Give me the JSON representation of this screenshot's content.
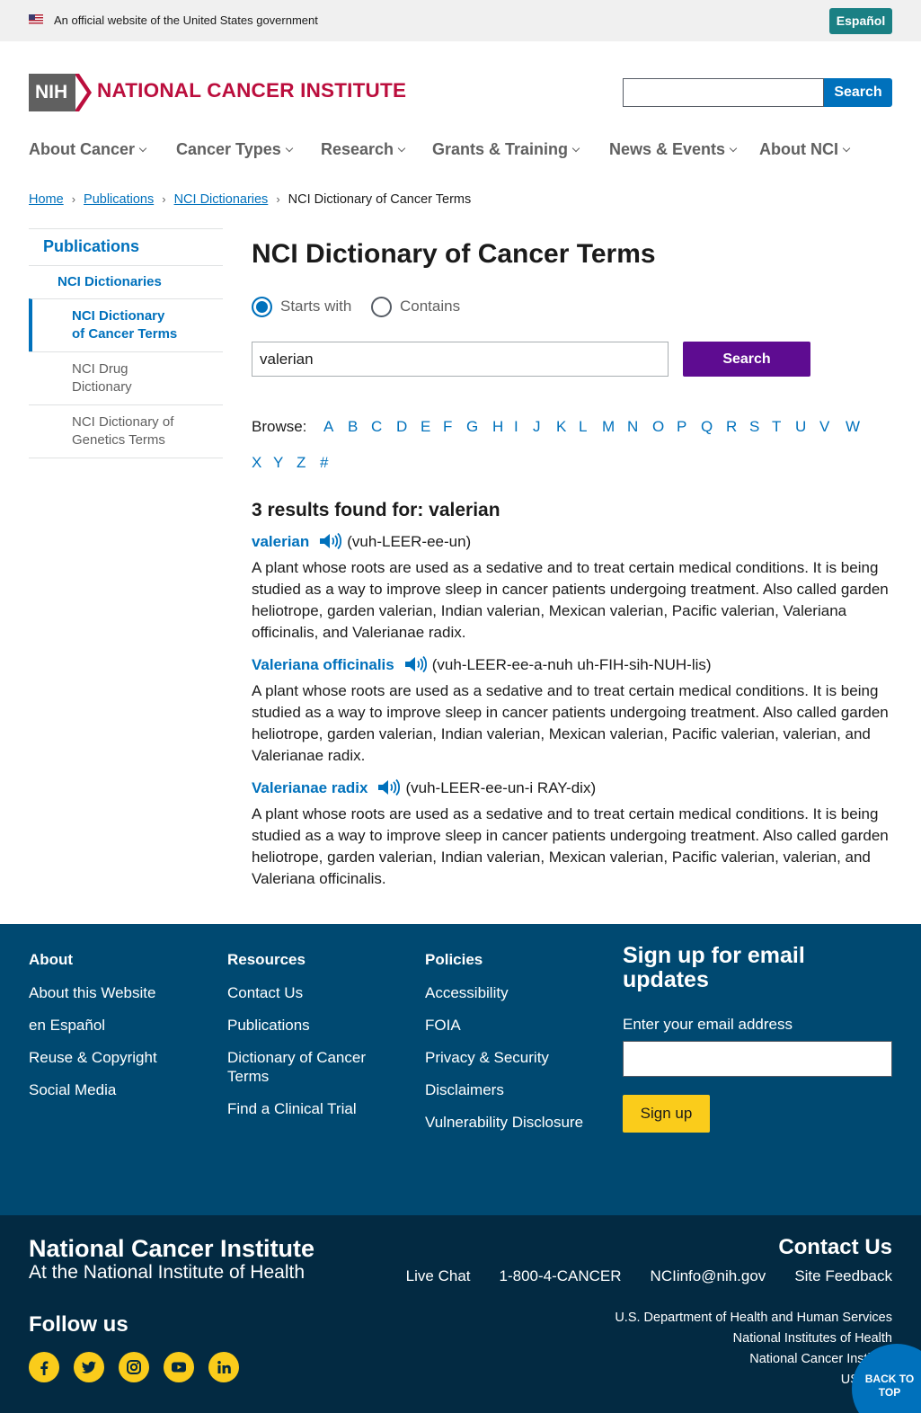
{
  "gov_banner": {
    "text": "An official website of the United States government",
    "espanol": "Español"
  },
  "header": {
    "logo_abbr": "NIH",
    "logo_name": "NATIONAL CANCER INSTITUTE",
    "search_button": "Search"
  },
  "nav": [
    "About Cancer",
    "Cancer Types",
    "Research",
    "Grants & Training",
    "News & Events",
    "About NCI"
  ],
  "breadcrumb": {
    "home": "Home",
    "publications": "Publications",
    "dictionaries": "NCI Dictionaries",
    "current": "NCI Dictionary of Cancer Terms"
  },
  "sidebar": {
    "publications": "Publications",
    "dictionaries": "NCI Dictionaries",
    "cancer_terms": "NCI Dictionary of Cancer Terms",
    "drug": "NCI Drug Dictionary",
    "genetics": "NCI Dictionary of Genetics Terms"
  },
  "main": {
    "title": "NCI Dictionary of Cancer Terms",
    "radio_starts": "Starts with",
    "radio_contains": "Contains",
    "search_value": "valerian",
    "search_button": "Search",
    "browse_label": "Browse:",
    "letters": [
      "A",
      "B",
      "C",
      "D",
      "E",
      "F",
      "G",
      "H",
      "I",
      "J",
      "K",
      "L",
      "M",
      "N",
      "O",
      "P",
      "Q",
      "R",
      "S",
      "T",
      "U",
      "V",
      "W",
      "X",
      "Y",
      "Z",
      "#"
    ],
    "results_heading": "3 results found for: valerian",
    "results": [
      {
        "term": "valerian",
        "pronunciation": "(vuh-LEER-ee-un)",
        "definition": "A plant whose roots are used as a sedative and to treat certain medical conditions. It is being studied as a way to improve sleep in cancer patients undergoing treatment. Also called garden heliotrope, garden valerian, Indian valerian, Mexican valerian, Pacific valerian, Valeriana officinalis, and Valerianae radix."
      },
      {
        "term": "Valeriana officinalis",
        "pronunciation": "(vuh-LEER-ee-a-nuh uh-FIH-sih-NUH-lis)",
        "definition": "A plant whose roots are used as a sedative and to treat certain medical conditions. It is being studied as a way to improve sleep in cancer patients undergoing treatment. Also called garden heliotrope, garden valerian, Indian valerian, Mexican valerian, Pacific valerian, valerian, and Valerianae radix."
      },
      {
        "term": "Valerianae radix",
        "pronunciation": "(vuh-LEER-ee-un-i RAY-dix)",
        "definition": "A plant whose roots are used as a sedative and to treat certain medical conditions. It is being studied as a way to improve sleep in cancer patients undergoing treatment. Also called garden heliotrope, garden valerian, Indian valerian, Mexican valerian, Pacific valerian, valerian, and Valeriana officinalis."
      }
    ]
  },
  "footer": {
    "about": {
      "title": "About",
      "links": [
        "About this Website",
        "en Español",
        "Reuse & Copyright",
        "Social Media"
      ]
    },
    "resources": {
      "title": "Resources",
      "links": [
        "Contact Us",
        "Publications",
        "Dictionary of Cancer Terms",
        "Find a Clinical Trial"
      ]
    },
    "policies": {
      "title": "Policies",
      "links": [
        "Accessibility",
        "FOIA",
        "Privacy & Security",
        "Disclaimers",
        "Vulnerability Disclosure"
      ]
    },
    "signup_title": "Sign up for email updates",
    "signup_label": "Enter your email address",
    "signup_button": "Sign up",
    "nci_name": "National Cancer Institute",
    "nci_sub": "At the National Institute of Health",
    "follow_us": "Follow us",
    "social": [
      "facebook-icon",
      "twitter-icon",
      "instagram-icon",
      "youtube-icon",
      "linkedin-icon"
    ],
    "contact_title": "Contact Us",
    "contact_links": [
      "Live Chat",
      "1-800-4-CANCER",
      "NCIinfo@nih.gov",
      "Site Feedback"
    ],
    "gov_links": [
      "U.S. Department of Health and Human Services",
      "National Institutes of Health",
      "National Cancer Institute",
      "USA.gov"
    ],
    "back_to_top": "BACK TO TOP"
  },
  "colors": {
    "nci_red": "#bb0e3d",
    "link_blue": "#0071bc",
    "purple_button": "#5e0c91",
    "footer_blue": "#004971",
    "footer_dark": "#032a42",
    "signup_yellow": "#facc1b",
    "espanol_teal": "#1a8084"
  }
}
